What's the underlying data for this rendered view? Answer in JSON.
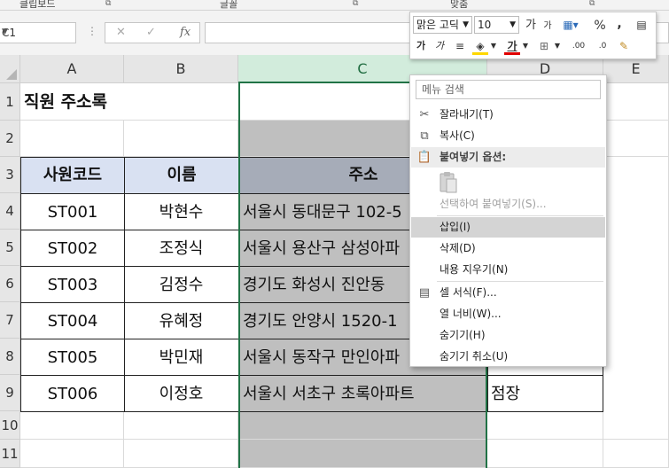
{
  "ribbon_groups": {
    "clipboard": "클립보드",
    "font": "글꼴",
    "alignment": "맞춤"
  },
  "formula_bar": {
    "name_box": "C1",
    "cancel_icon": "✕",
    "enter_icon": "✓",
    "fx_icon": "fx",
    "formula": ""
  },
  "columns": [
    "A",
    "B",
    "C",
    "D",
    "E"
  ],
  "rows": [
    "1",
    "2",
    "3",
    "4",
    "5",
    "6",
    "7",
    "8",
    "9",
    "10",
    "11"
  ],
  "sheet": {
    "title": "직원 주소록",
    "headers": {
      "code": "사원코드",
      "name": "이름",
      "address": "주소"
    },
    "records": [
      {
        "code": "ST001",
        "name": "박현수",
        "address": "서울시 동대문구 102-5"
      },
      {
        "code": "ST002",
        "name": "조정식",
        "address": "서울시 용산구 삼성아파"
      },
      {
        "code": "ST003",
        "name": "김정수",
        "address": "경기도 화성시 진안동"
      },
      {
        "code": "ST004",
        "name": "유혜정",
        "address": "경기도 안양시 1520-1"
      },
      {
        "code": "ST005",
        "name": "박민재",
        "address": "서울시 동작구 만인아파"
      },
      {
        "code": "ST006",
        "name": "이정호",
        "address": "서울시 서초구 초록아파트",
        "extra": "점장"
      }
    ]
  },
  "mini_toolbar": {
    "font": "맑은 고딕",
    "size": "10",
    "grow": "가",
    "shrink": "가",
    "percent": "%",
    "comma": ",",
    "bold": "가",
    "italic": "가",
    "font_color": "가",
    "dec_inc": ".00",
    "dec_dec": ".0"
  },
  "context_menu": {
    "search_placeholder": "메뉴 검색",
    "items": [
      {
        "label": "잘라내기(T)",
        "icon": "scissors-icon"
      },
      {
        "label": "복사(C)",
        "icon": "copy-icon"
      },
      {
        "label": "붙여넣기 옵션:",
        "icon": "paste-icon",
        "section": true
      },
      {
        "label": "선택하여 붙여넣기(S)...",
        "disabled": true
      },
      {
        "label": "삽입(I)",
        "highlighted": true
      },
      {
        "label": "삭제(D)"
      },
      {
        "label": "내용 지우기(N)"
      },
      {
        "label": "셀 서식(F)...",
        "icon": "format-cells-icon"
      },
      {
        "label": "열 너비(W)..."
      },
      {
        "label": "숨기기(H)"
      },
      {
        "label": "숨기기 취소(U)"
      }
    ]
  },
  "colors": {
    "header_fill": "#d9e1f2",
    "selection_fill": "#bfbfbf",
    "excel_green": "#217346",
    "fill_yellow": "#ffd700",
    "font_red": "#e00000"
  }
}
